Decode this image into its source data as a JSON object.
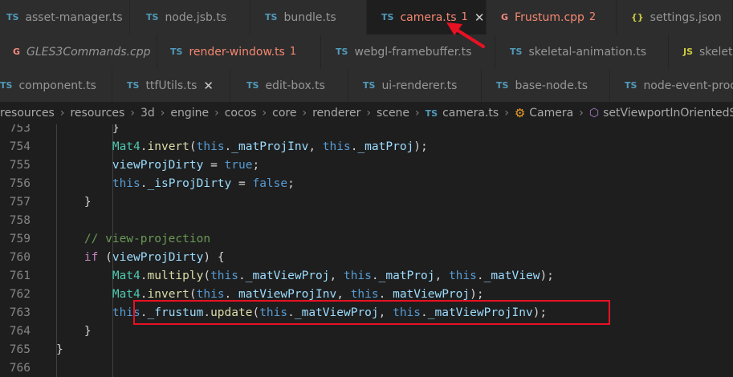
{
  "tab_rows": [
    [
      {
        "label": "asset-manager.ts",
        "icon": "TS",
        "kind": "ts"
      },
      {
        "label": "node.jsb.ts",
        "icon": "TS",
        "kind": "ts"
      },
      {
        "label": "bundle.ts",
        "icon": "TS",
        "kind": "ts"
      },
      {
        "label": "camera.ts",
        "icon": "TS",
        "kind": "ts",
        "count": "1",
        "active": true,
        "error": true,
        "close": "✕"
      },
      {
        "label": "Frustum.cpp",
        "icon": "G",
        "kind": "cpp",
        "count": "2",
        "error": true
      },
      {
        "label": "settings.json",
        "icon": "{}",
        "kind": "json"
      }
    ],
    [
      {
        "label": "GLES3Commands.cpp",
        "icon": "G",
        "kind": "cpp",
        "italic": true
      },
      {
        "label": "render-window.ts",
        "icon": "TS",
        "kind": "ts",
        "count": "1",
        "error": true
      },
      {
        "label": "webgl-framebuffer.ts",
        "icon": "TS",
        "kind": "ts"
      },
      {
        "label": "skeletal-animation.ts",
        "icon": "TS",
        "kind": "ts"
      },
      {
        "label": "skeleta",
        "icon": "JS",
        "kind": "js"
      }
    ],
    [
      {
        "label": "component.ts",
        "icon": "TS",
        "kind": "ts"
      },
      {
        "label": "ttfUtils.ts",
        "icon": "TS",
        "kind": "ts",
        "close": "✕"
      },
      {
        "label": "edit-box.ts",
        "icon": "TS",
        "kind": "ts"
      },
      {
        "label": "ui-renderer.ts",
        "icon": "TS",
        "kind": "ts"
      },
      {
        "label": "base-node.ts",
        "icon": "TS",
        "kind": "ts"
      },
      {
        "label": "node-event-proc",
        "icon": "TS",
        "kind": "ts"
      }
    ]
  ],
  "breadcrumb": {
    "segments": [
      "resources",
      "resources",
      "3d",
      "engine",
      "cocos",
      "core",
      "renderer",
      "scene"
    ],
    "file": {
      "icon": "TS",
      "label": "camera.ts"
    },
    "class_label": "Camera",
    "method_label": "setViewportInOrientedSp"
  },
  "code_lines": [
    {
      "num": "753",
      "tokens": [
        [
          "p",
          "        }"
        ]
      ]
    },
    {
      "num": "754",
      "tokens": [
        [
          "p",
          "        "
        ],
        [
          "t",
          "Mat4"
        ],
        [
          "p",
          "."
        ],
        [
          "f",
          "invert"
        ],
        [
          "p",
          "("
        ],
        [
          "k",
          "this"
        ],
        [
          "p",
          "."
        ],
        [
          "v",
          "_matProjInv"
        ],
        [
          "p",
          ", "
        ],
        [
          "k",
          "this"
        ],
        [
          "p",
          "."
        ],
        [
          "v",
          "_matProj"
        ],
        [
          "p",
          ");"
        ]
      ]
    },
    {
      "num": "755",
      "tokens": [
        [
          "p",
          "        "
        ],
        [
          "v",
          "viewProjDirty"
        ],
        [
          "p",
          " = "
        ],
        [
          "k",
          "true"
        ],
        [
          "p",
          ";"
        ]
      ]
    },
    {
      "num": "756",
      "tokens": [
        [
          "p",
          "        "
        ],
        [
          "k",
          "this"
        ],
        [
          "p",
          "."
        ],
        [
          "v",
          "_isProjDirty"
        ],
        [
          "p",
          " = "
        ],
        [
          "k",
          "false"
        ],
        [
          "p",
          ";"
        ]
      ]
    },
    {
      "num": "757",
      "tokens": [
        [
          "p",
          "    }"
        ]
      ]
    },
    {
      "num": "758",
      "tokens": []
    },
    {
      "num": "759",
      "tokens": [
        [
          "p",
          "    "
        ],
        [
          "c",
          "// view-projection"
        ]
      ]
    },
    {
      "num": "760",
      "tokens": [
        [
          "p",
          "    "
        ],
        [
          "ck",
          "if"
        ],
        [
          "p",
          " ("
        ],
        [
          "v",
          "viewProjDirty"
        ],
        [
          "p",
          ") {"
        ]
      ]
    },
    {
      "num": "761",
      "tokens": [
        [
          "p",
          "        "
        ],
        [
          "t",
          "Mat4"
        ],
        [
          "p",
          "."
        ],
        [
          "f",
          "multiply"
        ],
        [
          "p",
          "("
        ],
        [
          "k",
          "this"
        ],
        [
          "p",
          "."
        ],
        [
          "v",
          "_matViewProj"
        ],
        [
          "p",
          ", "
        ],
        [
          "k",
          "this"
        ],
        [
          "p",
          "."
        ],
        [
          "v",
          "_matProj"
        ],
        [
          "p",
          ", "
        ],
        [
          "k",
          "this"
        ],
        [
          "p",
          "."
        ],
        [
          "v",
          "_matView"
        ],
        [
          "p",
          ");"
        ]
      ]
    },
    {
      "num": "762",
      "tokens": [
        [
          "p",
          "        "
        ],
        [
          "t",
          "Mat4"
        ],
        [
          "p",
          "."
        ],
        [
          "f",
          "invert"
        ],
        [
          "p",
          "("
        ],
        [
          "k",
          "this"
        ],
        [
          "p",
          "."
        ],
        [
          "v",
          "_matViewProjInv"
        ],
        [
          "p",
          ", "
        ],
        [
          "k",
          "this"
        ],
        [
          "p",
          "."
        ],
        [
          "v",
          "_matViewProj"
        ],
        [
          "p",
          ");"
        ]
      ]
    },
    {
      "num": "763",
      "tokens": [
        [
          "p",
          "        "
        ],
        [
          "k",
          "this"
        ],
        [
          "p",
          "."
        ],
        [
          "v",
          "_frustum"
        ],
        [
          "p",
          "."
        ],
        [
          "f",
          "update"
        ],
        [
          "p",
          "("
        ],
        [
          "k",
          "this"
        ],
        [
          "p",
          "."
        ],
        [
          "v",
          "_matViewProj"
        ],
        [
          "p",
          ", "
        ],
        [
          "k",
          "this"
        ],
        [
          "p",
          "."
        ],
        [
          "v",
          "_matViewProjInv"
        ],
        [
          "p",
          ");"
        ]
      ]
    },
    {
      "num": "764",
      "tokens": [
        [
          "p",
          "    }"
        ]
      ]
    },
    {
      "num": "765",
      "tokens": [
        [
          "p",
          "}"
        ]
      ]
    },
    {
      "num": "766",
      "tokens": []
    }
  ],
  "colors": {
    "annotation": "#e81123",
    "error_tab": "#f48771",
    "keyword": "#569cd6",
    "control_keyword": "#c586c0",
    "comment": "#6a9955",
    "type": "#4ec9b0",
    "function": "#dcdcaa",
    "variable": "#9cdcfe"
  }
}
